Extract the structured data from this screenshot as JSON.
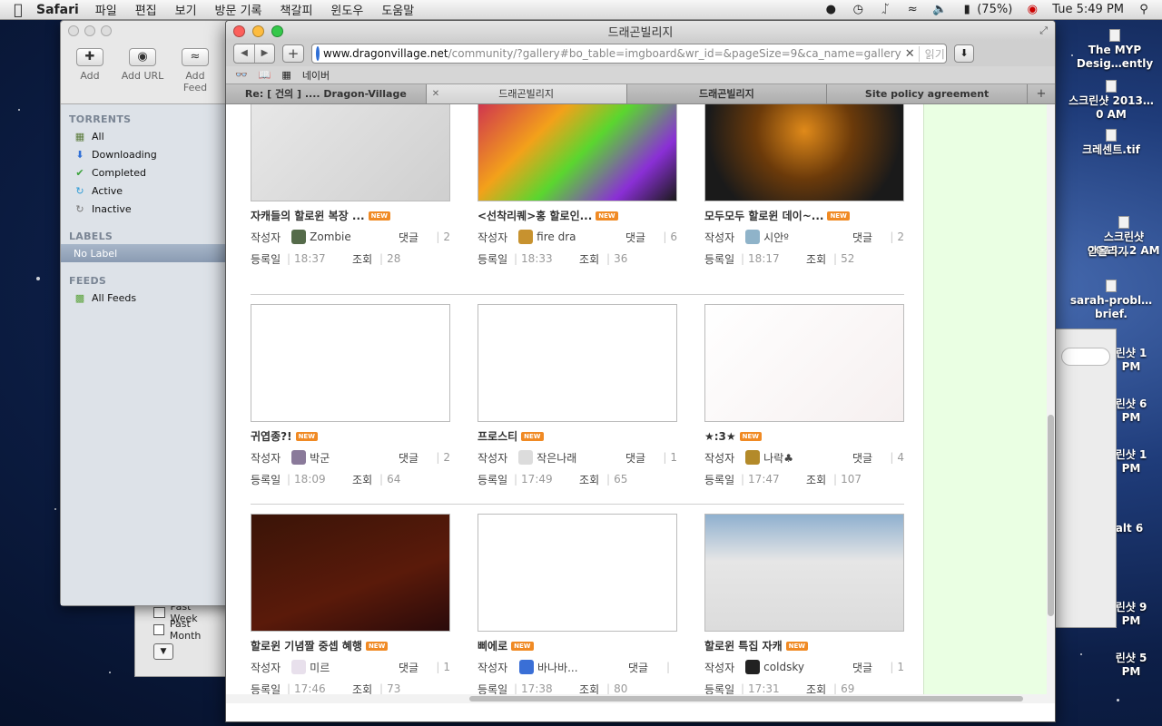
{
  "menubar": {
    "apple": "",
    "app_name": "Safari",
    "menus": [
      "파일",
      "편집",
      "보기",
      "방문 기록",
      "책갈피",
      "윈도우",
      "도움말"
    ],
    "battery": "(75%)",
    "clock": "Tue 5:49 PM"
  },
  "desktop_icons": [
    {
      "label": "The MYP Desig…ently"
    },
    {
      "label": "스크린샷 2013…0 AM"
    },
    {
      "label": "크레센트.tif"
    },
    {
      "label": "스크린샷 2013…2 AM"
    },
    {
      "label": "안올리기"
    },
    {
      "label": "sarah-probl…brief."
    },
    {
      "label": "린샷 1 PM"
    },
    {
      "label": "린샷 6 PM"
    },
    {
      "label": "린샷 1 PM"
    },
    {
      "label": "alt 6"
    },
    {
      "label": "린샷 9 PM"
    },
    {
      "label": "린샷 5 PM"
    }
  ],
  "transmission": {
    "toolbar": [
      {
        "label": "Add",
        "icon": "add-torrent-icon"
      },
      {
        "label": "Add URL",
        "icon": "globe-icon"
      },
      {
        "label": "Add Feed",
        "icon": "rss-icon"
      }
    ],
    "sections": {
      "torrents": "TORRENTS",
      "labels": "LABELS",
      "feeds": "FEEDS"
    },
    "torrent_items": [
      "All",
      "Downloading",
      "Completed",
      "Active",
      "Inactive"
    ],
    "label_items": [
      "No Label"
    ],
    "feed_items": [
      "All Feeds"
    ]
  },
  "finder_panel": {
    "items": [
      "Past Week",
      "Past Month"
    ]
  },
  "safari": {
    "title": "드래곤빌리지",
    "url_host": "www.dragonvillage.net",
    "url_path": "/community/?gallery#bo_table=imgboard&wr_id=&pageSize=9&ca_name=gallery",
    "reader_label": "읽기 도구",
    "bookmark_label": "네이버",
    "tabs": [
      {
        "label": "Re: [ 건의 ] .... Dragon-Village"
      },
      {
        "label": "드래곤빌리지"
      },
      {
        "label": "드래곤빌리지"
      },
      {
        "label": "Site policy agreement"
      }
    ]
  },
  "gallery": {
    "author_label": "작성자",
    "comment_label": "댓글",
    "date_label": "등록일",
    "views_label": "조회",
    "new_badge": "NEW",
    "posts": [
      {
        "title": "자캐들의 할로윈 복장 ...",
        "author": "Zombie",
        "comments": "2",
        "time": "18:37",
        "views": "28",
        "avatar_color": "#556b4a"
      },
      {
        "title": "<선착리퀘>홍 할로인...",
        "author": "fire dra",
        "comments": "6",
        "time": "18:33",
        "views": "36",
        "avatar_color": "#c7922f"
      },
      {
        "title": "모두모두 할로윈 데이~...",
        "author": "시안º",
        "comments": "2",
        "time": "18:17",
        "views": "52",
        "avatar_color": "#8fb3c9"
      },
      {
        "title": "귀엽종?!",
        "author": "박군",
        "comments": "2",
        "time": "18:09",
        "views": "64",
        "avatar_color": "#8a7a9a"
      },
      {
        "title": "프로스티",
        "author": "작은나래",
        "comments": "1",
        "time": "17:49",
        "views": "65",
        "avatar_color": "#dcdcdc"
      },
      {
        "title": "★:3★",
        "author": "나락♣",
        "comments": "4",
        "time": "17:47",
        "views": "107",
        "avatar_color": "#b38a2a"
      },
      {
        "title": "할로윈 기념짤 중셉 혜행",
        "author": "미르",
        "comments": "1",
        "time": "17:46",
        "views": "73",
        "avatar_color": "#e8e0ec"
      },
      {
        "title": "삐에로",
        "author": "바나바...",
        "comments": "",
        "time": "17:38",
        "views": "80",
        "avatar_color": "#3a6fd6"
      },
      {
        "title": "할로윈 특집 자캐",
        "author": "coldsky",
        "comments": "1",
        "time": "17:31",
        "views": "69",
        "avatar_color": "#222222"
      }
    ]
  }
}
